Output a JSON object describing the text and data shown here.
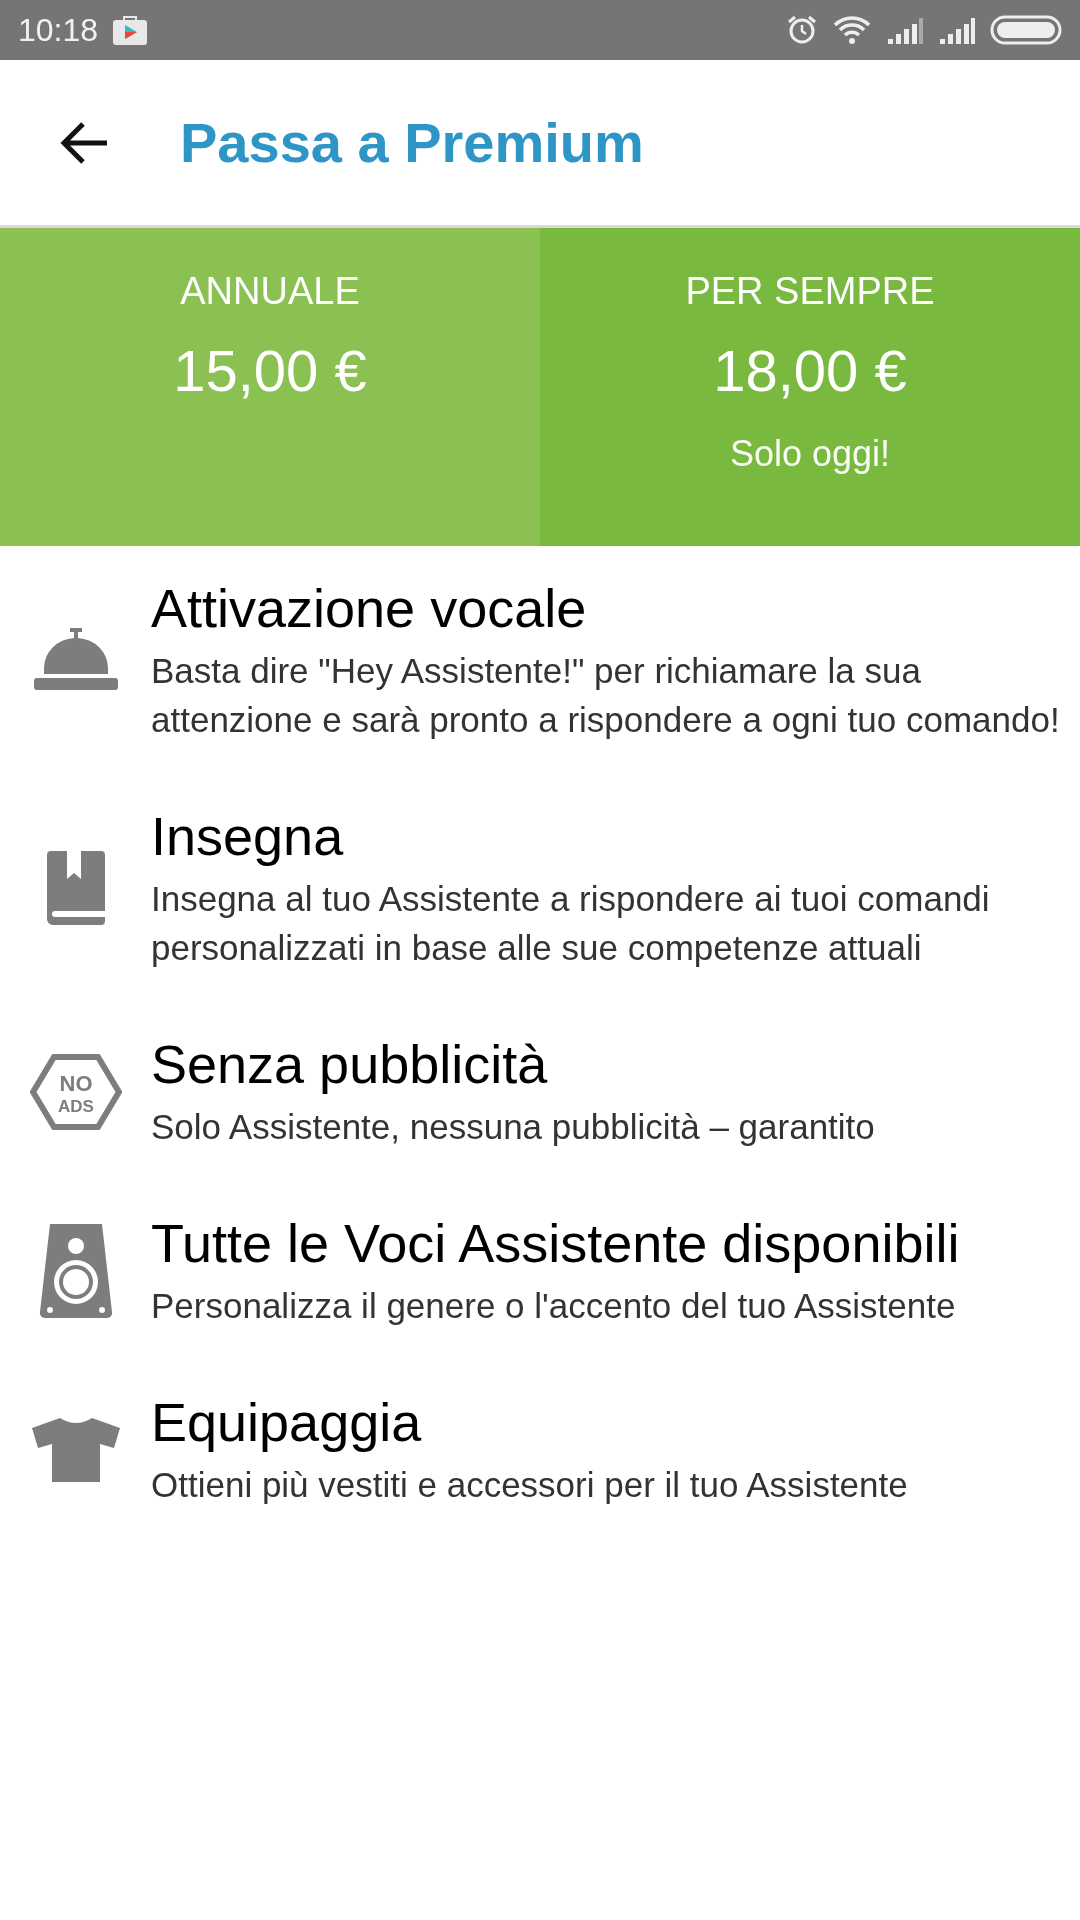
{
  "status_bar": {
    "time": "10:18"
  },
  "header": {
    "title": "Passa a Premium"
  },
  "plans": [
    {
      "name": "ANNUALE",
      "price": "15,00 €",
      "selected": false
    },
    {
      "name": "PER SEMPRE",
      "price": "18,00 €",
      "note": "Solo oggi!",
      "selected": true
    }
  ],
  "features": [
    {
      "kind": "bell",
      "title": "Attivazione vocale",
      "description": "Basta dire \"Hey Assistente!\" per richiamare la sua attenzione e sarà pronto a rispondere a ogni tuo comando!"
    },
    {
      "kind": "book",
      "title": "Insegna",
      "description": "Insegna al tuo Assistente a rispondere ai tuoi comandi personalizzati in base alle sue competenze attuali"
    },
    {
      "kind": "noads",
      "icon_text": [
        "NO",
        "ADS"
      ],
      "title": "Senza pubblicità",
      "description": "Solo Assistente, nessuna pubblicità – garantito"
    },
    {
      "kind": "speaker",
      "title": "Tutte le Voci Assistente disponibili",
      "description": "Personalizza il genere o l'accento del tuo Assistente"
    },
    {
      "kind": "shirt",
      "title": "Equipaggia",
      "description": "Ottieni più vestiti e accessori per il tuo Assistente"
    }
  ]
}
